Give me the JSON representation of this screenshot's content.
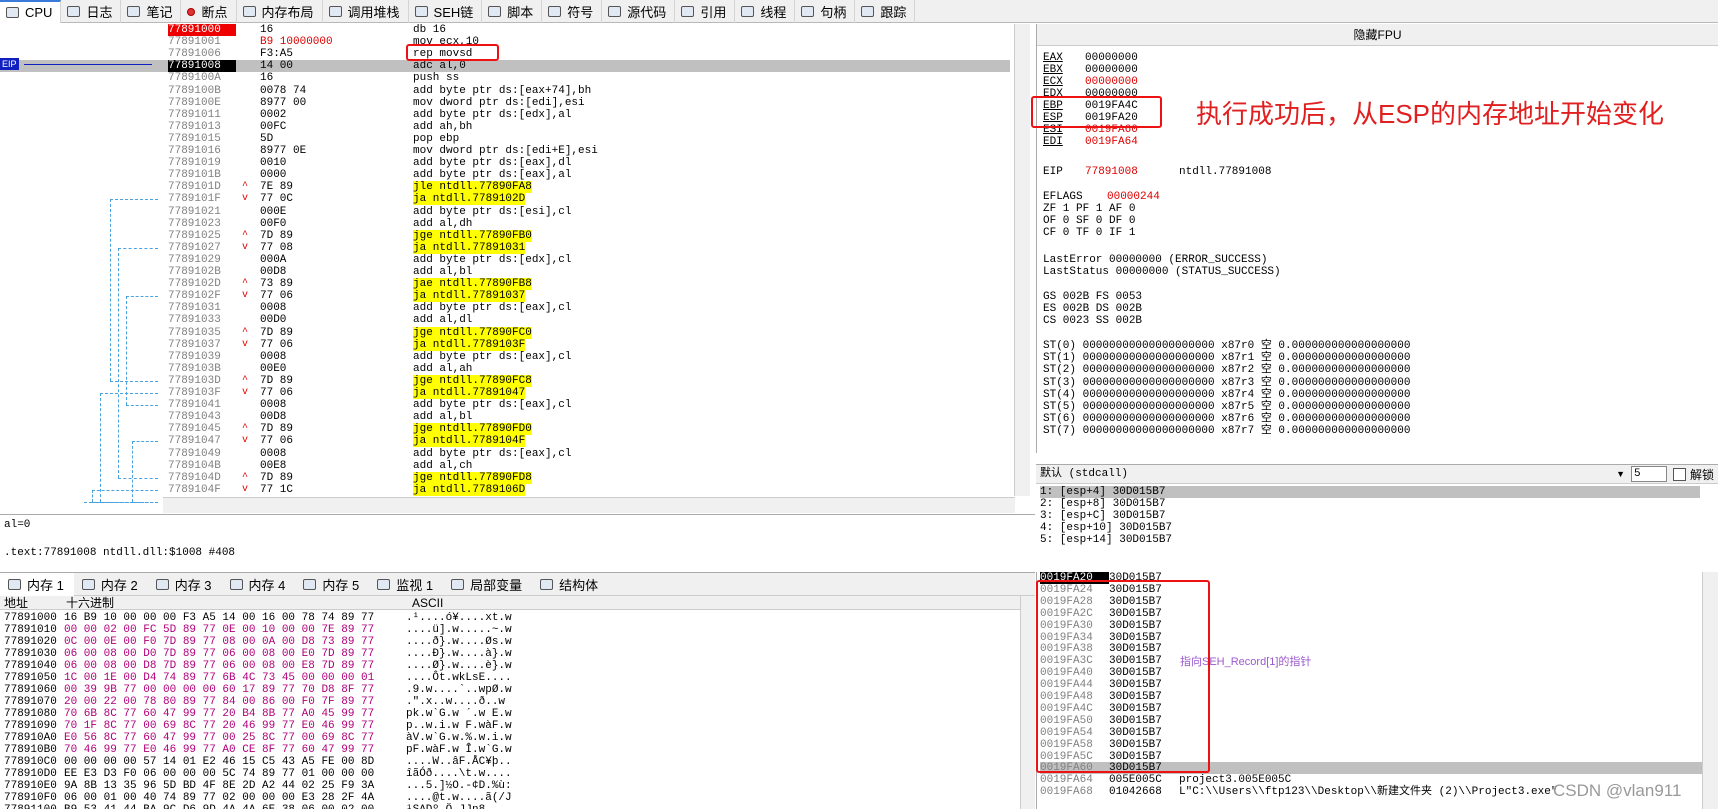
{
  "tabs": [
    {
      "label": "CPU",
      "icon": "cpu-icon"
    },
    {
      "label": "日志",
      "icon": "log-icon"
    },
    {
      "label": "笔记",
      "icon": "notes-icon"
    },
    {
      "label": "断点",
      "icon": "breakpoint-icon"
    },
    {
      "label": "内存布局",
      "icon": "memory-map-icon"
    },
    {
      "label": "调用堆栈",
      "icon": "call-stack-icon"
    },
    {
      "label": "SEH链",
      "icon": "seh-icon"
    },
    {
      "label": "脚本",
      "icon": "script-icon"
    },
    {
      "label": "符号",
      "icon": "symbols-icon"
    },
    {
      "label": "源代码",
      "icon": "source-icon"
    },
    {
      "label": "引用",
      "icon": "references-icon"
    },
    {
      "label": "线程",
      "icon": "threads-icon"
    },
    {
      "label": "句柄",
      "icon": "handles-icon"
    },
    {
      "label": "跟踪",
      "icon": "trace-icon"
    }
  ],
  "eip_label": "EIP",
  "disasm": [
    {
      "addr": "77891000",
      "bytes": "16",
      "instr": "db 16",
      "mark": "",
      "state": "bp"
    },
    {
      "addr": "77891001",
      "bytes": "B9 10000000",
      "instr": "mov ecx,10",
      "mark": "",
      "state": ""
    },
    {
      "addr": "77891006",
      "bytes": "F3:A5",
      "instr": "rep movsd",
      "mark": "",
      "state": ""
    },
    {
      "addr": "77891008",
      "bytes": "14 00",
      "instr": "adc al,0",
      "mark": "",
      "state": "cur"
    },
    {
      "addr": "7789100A",
      "bytes": "16",
      "instr": "push ss",
      "mark": "",
      "state": ""
    },
    {
      "addr": "7789100B",
      "bytes": "0078 74",
      "instr": "add byte ptr ds:[eax+74],bh",
      "mark": "",
      "state": ""
    },
    {
      "addr": "7789100E",
      "bytes": "8977 00",
      "instr": "mov dword ptr ds:[edi],esi",
      "mark": "",
      "state": ""
    },
    {
      "addr": "77891011",
      "bytes": "0002",
      "instr": "add byte ptr ds:[edx],al",
      "mark": "",
      "state": ""
    },
    {
      "addr": "77891013",
      "bytes": "00FC",
      "instr": "add ah,bh",
      "mark": "",
      "state": ""
    },
    {
      "addr": "77891015",
      "bytes": "5D",
      "instr": "pop ebp",
      "mark": "",
      "state": ""
    },
    {
      "addr": "77891016",
      "bytes": "8977 0E",
      "instr": "mov dword ptr ds:[edi+E],esi",
      "mark": "",
      "state": ""
    },
    {
      "addr": "77891019",
      "bytes": "0010",
      "instr": "add byte ptr ds:[eax],dl",
      "mark": "",
      "state": ""
    },
    {
      "addr": "7789101B",
      "bytes": "0000",
      "instr": "add byte ptr ds:[eax],al",
      "mark": "",
      "state": ""
    },
    {
      "addr": "7789101D",
      "bytes": "7E 89",
      "instr": "jle ntdll.77890FA8",
      "mark": "^",
      "state": ""
    },
    {
      "addr": "7789101F",
      "bytes": "77 0C",
      "instr": "ja ntdll.7789102D",
      "mark": "v",
      "state": ""
    },
    {
      "addr": "77891021",
      "bytes": "000E",
      "instr": "add byte ptr ds:[esi],cl",
      "mark": "",
      "state": ""
    },
    {
      "addr": "77891023",
      "bytes": "00F0",
      "instr": "add al,dh",
      "mark": "",
      "state": ""
    },
    {
      "addr": "77891025",
      "bytes": "7D 89",
      "instr": "jge ntdll.77890FB0",
      "mark": "^",
      "state": ""
    },
    {
      "addr": "77891027",
      "bytes": "77 08",
      "instr": "ja ntdll.77891031",
      "mark": "v",
      "state": ""
    },
    {
      "addr": "77891029",
      "bytes": "000A",
      "instr": "add byte ptr ds:[edx],cl",
      "mark": "",
      "state": ""
    },
    {
      "addr": "7789102B",
      "bytes": "00D8",
      "instr": "add al,bl",
      "mark": "",
      "state": ""
    },
    {
      "addr": "7789102D",
      "bytes": "73 89",
      "instr": "jae ntdll.77890FB8",
      "mark": "^",
      "state": ""
    },
    {
      "addr": "7789102F",
      "bytes": "77 06",
      "instr": "ja ntdll.77891037",
      "mark": "v",
      "state": ""
    },
    {
      "addr": "77891031",
      "bytes": "0008",
      "instr": "add byte ptr ds:[eax],cl",
      "mark": "",
      "state": ""
    },
    {
      "addr": "77891033",
      "bytes": "00D0",
      "instr": "add al,dl",
      "mark": "",
      "state": ""
    },
    {
      "addr": "77891035",
      "bytes": "7D 89",
      "instr": "jge ntdll.77890FC0",
      "mark": "^",
      "state": ""
    },
    {
      "addr": "77891037",
      "bytes": "77 06",
      "instr": "ja ntdll.7789103F",
      "mark": "v",
      "state": ""
    },
    {
      "addr": "77891039",
      "bytes": "0008",
      "instr": "add byte ptr ds:[eax],cl",
      "mark": "",
      "state": ""
    },
    {
      "addr": "7789103B",
      "bytes": "00E0",
      "instr": "add al,ah",
      "mark": "",
      "state": ""
    },
    {
      "addr": "7789103D",
      "bytes": "7D 89",
      "instr": "jge ntdll.77890FC8",
      "mark": "^",
      "state": ""
    },
    {
      "addr": "7789103F",
      "bytes": "77 06",
      "instr": "ja ntdll.77891047",
      "mark": "v",
      "state": ""
    },
    {
      "addr": "77891041",
      "bytes": "0008",
      "instr": "add byte ptr ds:[eax],cl",
      "mark": "",
      "state": ""
    },
    {
      "addr": "77891043",
      "bytes": "00D8",
      "instr": "add al,bl",
      "mark": "",
      "state": ""
    },
    {
      "addr": "77891045",
      "bytes": "7D 89",
      "instr": "jge ntdll.77890FD0",
      "mark": "^",
      "state": ""
    },
    {
      "addr": "77891047",
      "bytes": "77 06",
      "instr": "ja ntdll.7789104F",
      "mark": "v",
      "state": ""
    },
    {
      "addr": "77891049",
      "bytes": "0008",
      "instr": "add byte ptr ds:[eax],cl",
      "mark": "",
      "state": ""
    },
    {
      "addr": "7789104B",
      "bytes": "00E8",
      "instr": "add al,ch",
      "mark": "",
      "state": ""
    },
    {
      "addr": "7789104D",
      "bytes": "7D 89",
      "instr": "jge ntdll.77890FD8",
      "mark": "^",
      "state": ""
    },
    {
      "addr": "7789104F",
      "bytes": "77 1C",
      "instr": "ja ntdll.7789106D",
      "mark": "v",
      "state": ""
    },
    {
      "addr": "77891051",
      "bytes": "001E",
      "instr": "add byte ptr ds:[esi],bl",
      "mark": "",
      "state": ""
    },
    {
      "addr": "77891053",
      "bytes": "00D4",
      "instr": "add ah,dl",
      "mark": "",
      "state": ""
    }
  ],
  "info": {
    "line1": "al=0",
    "line2": ".text:77891008 ntdll.dll:$1008 #408"
  },
  "regs": {
    "header": "隐藏FPU",
    "gpr": [
      {
        "name": "EAX",
        "val": "00000000",
        "red": false
      },
      {
        "name": "EBX",
        "val": "00000000",
        "red": false
      },
      {
        "name": "ECX",
        "val": "00000000",
        "red": true
      },
      {
        "name": "EDX",
        "val": "00000000",
        "red": false
      },
      {
        "name": "EBP",
        "val": "0019FA4C",
        "red": false
      },
      {
        "name": "ESP",
        "val": "0019FA20",
        "red": false
      },
      {
        "name": "ESI",
        "val": "0019FA60",
        "red": true
      },
      {
        "name": "EDI",
        "val": "0019FA64",
        "red": true
      }
    ],
    "eip": {
      "name": "EIP",
      "val": "77891008",
      "sym": "ntdll.77891008"
    },
    "eflags": {
      "name": "EFLAGS",
      "val": "00000244"
    },
    "flags1": "ZF 1  PF 1  AF 0",
    "flags2": "OF 0  SF 0  DF 0",
    "flags3": "CF 0  TF 0  IF 1",
    "lasterror": "LastError  00000000 (ERROR_SUCCESS)",
    "laststatus": "LastStatus 00000000 (STATUS_SUCCESS)",
    "seg1": "GS 002B  FS 0053",
    "seg2": "ES 002B  DS 002B",
    "seg3": "CS 0023  SS 002B",
    "st": [
      "ST(0) 00000000000000000000 x87r0 空 0.000000000000000000",
      "ST(1) 00000000000000000000 x87r1 空 0.000000000000000000",
      "ST(2) 00000000000000000000 x87r2 空 0.000000000000000000",
      "ST(3) 00000000000000000000 x87r3 空 0.000000000000000000",
      "ST(4) 00000000000000000000 x87r4 空 0.000000000000000000",
      "ST(5) 00000000000000000000 x87r5 空 0.000000000000000000",
      "ST(6) 00000000000000000000 x87r6 空 0.000000000000000000",
      "ST(7) 00000000000000000000 x87r7 空 0.000000000000000000"
    ],
    "note": "执行成功后，从ESP的内存地址开始变化"
  },
  "callconv": {
    "selected": "默认 (stdcall)",
    "count": "5",
    "unlock": "解锁"
  },
  "args": [
    "1: [esp+4] 30D015B7",
    "2: [esp+8] 30D015B7",
    "3: [esp+C] 30D015B7",
    "4: [esp+10] 30D015B7",
    "5: [esp+14] 30D015B7"
  ],
  "memtabs": [
    "内存 1",
    "内存 2",
    "内存 3",
    "内存 4",
    "内存 5",
    "监视 1",
    "局部变量",
    "结构体"
  ],
  "memhdr": {
    "addr": "地址",
    "hex": "十六进制",
    "ascii": "ASCII"
  },
  "mem": [
    {
      "a": "77891000",
      "x": "16 B9 10 00  00 00 F3 A5  14 00 16 00  78 74 89 77",
      "t": ".¹....ó¥....xt.w"
    },
    {
      "a": "77891010",
      "x": "00 00 02 00  FC 5D 89 77  0E 00 10 00  00 7E 89 77",
      "t": "....ü].w.....~.w"
    },
    {
      "a": "77891020",
      "x": "0C 00 0E 00  F0 7D 89 77  08 00 0A 00  D8 73 89 77",
      "t": "....ð}.w....Øs.w"
    },
    {
      "a": "77891030",
      "x": "06 00 08 00  D0 7D 89 77  06 00 08 00  E0 7D 89 77",
      "t": "....Ð}.w....à}.w"
    },
    {
      "a": "77891040",
      "x": "06 00 08 00  D8 7D 89 77  06 00 08 00  E8 7D 89 77",
      "t": "....Ø}.w....è}.w"
    },
    {
      "a": "77891050",
      "x": "1C 00 1E 00  D4 74 89 77  6B 4C 73 45  00 00 00 01",
      "t": "....Ôt.wkLsE...."
    },
    {
      "a": "77891060",
      "x": "00 39 9B 77  00 00 00 00  60 17 89 77  70 D8 8F 77",
      "t": ".9.w....`..wpØ.w"
    },
    {
      "a": "77891070",
      "x": "20 00 22 00  78 80 89 77  84 00 86 00  F0 7F 89 77",
      "t": " .\".x..w....ð..w"
    },
    {
      "a": "77891080",
      "x": "70 6B 8C 77  60 47 99 77  20 B4 8B 77  A0 45 99 77",
      "t": "pk.w`G.w ´.w E.w"
    },
    {
      "a": "77891090",
      "x": "70 1F 8C 77  00 69 8C 77  20 46 99 77  E0 46 99 77",
      "t": "p..w.i.w F.wàF.w"
    },
    {
      "a": "778910A0",
      "x": "E0 56 8C 77  60 47 99 77  00 25 8C 77  00 69 8C 77",
      "t": "àV.w`G.w.%.w.i.w"
    },
    {
      "a": "778910B0",
      "x": "70 46 99 77  E0 46 99 77  A0 CE 8F 77  60 47 99 77",
      "t": "pF.wàF.w Î.w`G.w"
    },
    {
      "a": "778910C0",
      "x": "00 00 00 00  57 14 01 E2  46 15 C5 43  A5 FE 00 8D",
      "t": "....W..âF.ÅC¥þ.."
    },
    {
      "a": "778910D0",
      "x": "EE E3 D3 F0  06 00 00 00  5C 74 89 77  01 00 00 00",
      "t": "îãÓð....\\t.w...."
    },
    {
      "a": "778910E0",
      "x": "9A 8B 13 35  96 5D BD 4F  8E 2D A2 44  02 25 F9 3A",
      "t": "...5.]½O.-¢D.%ù:"
    },
    {
      "a": "778910F0",
      "x": "06 00 01 00  40 74 89 77  02 00 00 00  E3 28 2F 4A",
      "t": "....@t.w....ã(/J"
    },
    {
      "a": "77891100",
      "x": "B9 53 41 44  BA 9C D6 9D  4A 4A 6E 38  06 00 02 00",
      "t": "¹SADº.Ö.JJn8...."
    }
  ],
  "stack": [
    {
      "a": "0019FA20",
      "v": "30D015B7",
      "c": ""
    },
    {
      "a": "0019FA24",
      "v": "30D015B7",
      "c": ""
    },
    {
      "a": "0019FA28",
      "v": "30D015B7",
      "c": ""
    },
    {
      "a": "0019FA2C",
      "v": "30D015B7",
      "c": ""
    },
    {
      "a": "0019FA30",
      "v": "30D015B7",
      "c": ""
    },
    {
      "a": "0019FA34",
      "v": "30D015B7",
      "c": ""
    },
    {
      "a": "0019FA38",
      "v": "30D015B7",
      "c": ""
    },
    {
      "a": "0019FA3C",
      "v": "30D015B7",
      "c": ""
    },
    {
      "a": "0019FA40",
      "v": "30D015B7",
      "c": ""
    },
    {
      "a": "0019FA44",
      "v": "30D015B7",
      "c": ""
    },
    {
      "a": "0019FA48",
      "v": "30D015B7",
      "c": ""
    },
    {
      "a": "0019FA4C",
      "v": "30D015B7",
      "c": ""
    },
    {
      "a": "0019FA50",
      "v": "30D015B7",
      "c": ""
    },
    {
      "a": "0019FA54",
      "v": "30D015B7",
      "c": ""
    },
    {
      "a": "0019FA58",
      "v": "30D015B7",
      "c": ""
    },
    {
      "a": "0019FA5C",
      "v": "30D015B7",
      "c": ""
    },
    {
      "a": "0019FA60",
      "v": "30D015B7",
      "c": ""
    },
    {
      "a": "0019FA64",
      "v": "005E005C",
      "c": "project3.005E005C"
    },
    {
      "a": "0019FA68",
      "v": "01042668",
      "c": "L\"C:\\\\Users\\\\ftp123\\\\Desktop\\\\新建文件夹 (2)\\\\Project3.exe\""
    }
  ],
  "stack_note": "指向SEH_Record[1]的指针",
  "watermark": "CSDN @vlan911",
  "colors": {
    "accent": "#3b7ad9",
    "annotation": "#ee1111",
    "highlight": "#ffff00",
    "reg_changed": "#dd0000"
  }
}
